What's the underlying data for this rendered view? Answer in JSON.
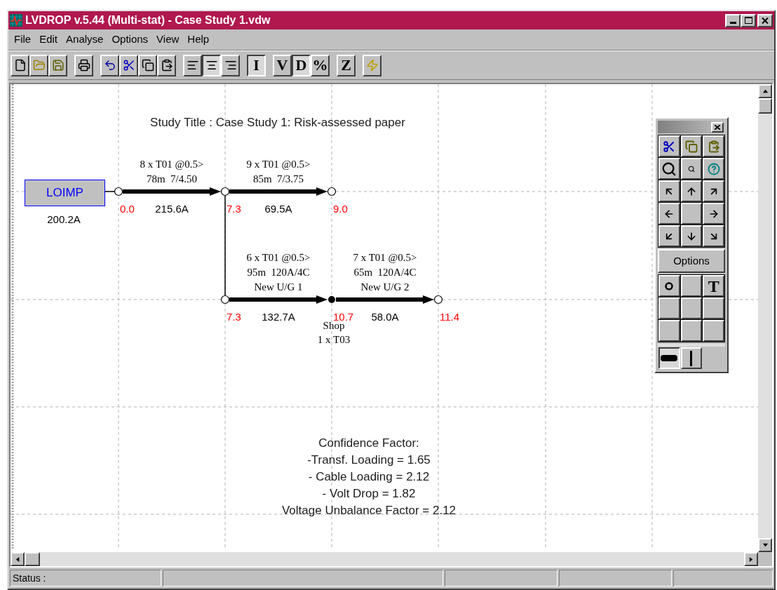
{
  "window": {
    "title": "LVDROP v.5.44 (Multi-stat) - Case Study 1.vdw"
  },
  "menu": [
    "File",
    "Edit",
    "Analyse",
    "Options",
    "View",
    "Help"
  ],
  "toolbar": [
    [
      {
        "kind": "icon",
        "pressed": false
      },
      {
        "kind": "icon",
        "pressed": false
      },
      {
        "kind": "icon",
        "pressed": false
      }
    ],
    [
      {
        "kind": "icon",
        "pressed": false
      }
    ],
    [
      {
        "kind": "icon",
        "pressed": false
      },
      {
        "kind": "icon",
        "pressed": false
      },
      {
        "kind": "icon",
        "pressed": false
      },
      {
        "kind": "icon",
        "pressed": false
      }
    ],
    [
      {
        "kind": "icon",
        "pressed": false
      },
      {
        "kind": "icon",
        "pressed": true
      },
      {
        "kind": "icon",
        "pressed": false
      }
    ],
    [
      {
        "kind": "letter",
        "label": "I",
        "pressed": true
      }
    ],
    [
      {
        "kind": "letter",
        "label": "V",
        "pressed": false
      },
      {
        "kind": "letter",
        "label": "D",
        "pressed": true
      },
      {
        "kind": "letter",
        "label": "%",
        "pressed": false
      }
    ],
    [
      {
        "kind": "letter",
        "label": "Z",
        "pressed": false
      }
    ],
    [
      {
        "kind": "icon",
        "pressed": false
      }
    ]
  ],
  "diagram": {
    "title": "Study Title : Case Study 1: Risk-assessed paper",
    "source": {
      "label": "LOIMP",
      "current": "200.2A"
    },
    "nodes": [
      {
        "voltage": "0.0",
        "kind": "open"
      },
      {
        "voltage": "7.3",
        "kind": "open"
      },
      {
        "voltage": "9.0",
        "kind": "open"
      },
      {
        "voltage": "7.3",
        "kind": "open"
      },
      {
        "voltage": "10.7",
        "kind": "tee"
      },
      {
        "voltage": "11.4",
        "kind": "open"
      }
    ],
    "cables": [
      {
        "lines": [
          "8 x T01 @0.5>",
          "78m  7/4.50"
        ],
        "current": "215.6A"
      },
      {
        "lines": [
          "9 x T01 @0.5>",
          "85m  7/3.75"
        ],
        "current": "69.5A"
      },
      {
        "lines": [
          "6 x T01 @0.5>",
          "95m  120A/4C",
          "New U/G 1"
        ],
        "current": "132.7A"
      },
      {
        "lines": [
          "7 x T01 @0.5>",
          "65m  120A/4C",
          "New U/G 2"
        ],
        "current": "58.0A"
      }
    ],
    "load": {
      "lines": [
        "Shop",
        "1 x T03"
      ]
    },
    "notes": [
      "Confidence Factor:",
      "-Transf. Loading = 1.65",
      "- Cable Loading = 2.12",
      "- Volt Drop = 1.82",
      "Voltage Unbalance Factor = 2.12"
    ]
  },
  "palette": {
    "options_label": "Options",
    "text_tool": "T"
  },
  "status_bar": [
    "Status :"
  ]
}
